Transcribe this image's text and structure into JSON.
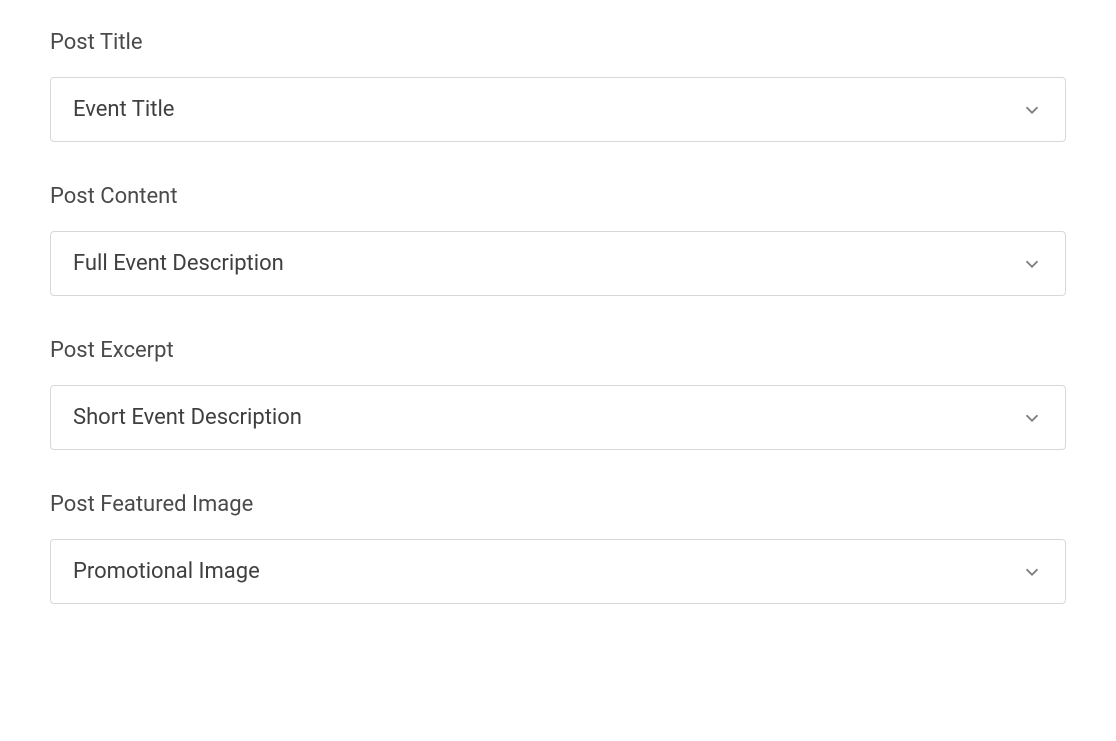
{
  "fields": [
    {
      "label": "Post Title",
      "value": "Event Title"
    },
    {
      "label": "Post Content",
      "value": "Full Event Description"
    },
    {
      "label": "Post Excerpt",
      "value": "Short Event Description"
    },
    {
      "label": "Post Featured Image",
      "value": "Promotional Image"
    }
  ]
}
